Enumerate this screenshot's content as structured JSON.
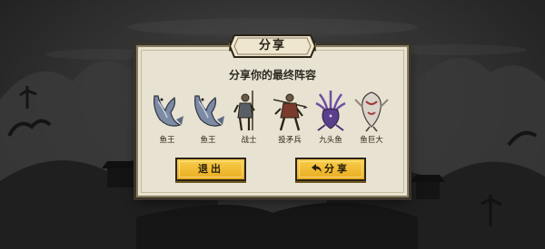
{
  "dialog": {
    "title": "分享",
    "subtitle": "分享你的最终阵容"
  },
  "lineup": [
    {
      "name": "鱼王",
      "icon": "fish-king-icon"
    },
    {
      "name": "鱼王",
      "icon": "fish-king-icon"
    },
    {
      "name": "战士",
      "icon": "warrior-icon"
    },
    {
      "name": "投矛兵",
      "icon": "spearman-icon"
    },
    {
      "name": "九头鱼",
      "icon": "nine-headed-fish-icon"
    },
    {
      "name": "鱼巨大",
      "icon": "giant-fish-icon"
    }
  ],
  "buttons": {
    "exit_label": "退出",
    "share_label": "分享"
  },
  "colors": {
    "button_yellow": "#f2bd34",
    "panel": "#e8e2d2",
    "background": "#2f2f2f"
  }
}
